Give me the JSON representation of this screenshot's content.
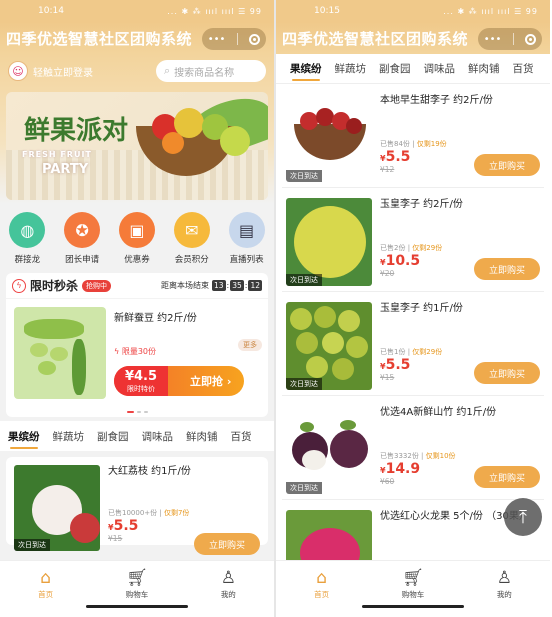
{
  "app_title": "四季优选智慧社区团购系统",
  "left": {
    "time": "10:14",
    "status_icons": "... ✱ ⁂ ıııl ıııl ☰ 99",
    "login_text": "轻触立即登录",
    "search_placeholder": "搜索商品名称",
    "banner": {
      "big": "鲜果派对",
      "sub1": "FRESH FRUIT",
      "sub2": "PARTY"
    },
    "quick_icons": [
      {
        "label": "群接龙",
        "icon": "leaf-icon",
        "color": "#45c49a",
        "glyph": "◍"
      },
      {
        "label": "团长申请",
        "icon": "badge-icon",
        "color": "#f4793e",
        "glyph": "✪"
      },
      {
        "label": "优惠券",
        "icon": "coupon-icon",
        "color": "#f57b39",
        "glyph": "▣"
      },
      {
        "label": "会员积分",
        "icon": "points-icon",
        "color": "#f6b93b",
        "glyph": "✉"
      },
      {
        "label": "直播列表",
        "icon": "live-icon",
        "color": "#c7d7ec",
        "glyph": "▤"
      }
    ],
    "flash": {
      "title": "限时秒杀",
      "tag": "抢购中",
      "end_label": "距离本场结束",
      "timer": [
        "13",
        "35",
        "12"
      ],
      "product": "新鲜蚕豆 约2斤/份",
      "limit": "限量30份",
      "more": "更多",
      "price": "¥4.5",
      "price_label": "限时特价",
      "grab": "立即抢"
    },
    "categories": [
      "果缤纷",
      "鲜蔬坊",
      "副食园",
      "调味品",
      "鲜肉铺",
      "百货"
    ],
    "product": {
      "name": "大红荔枝 约1斤/份",
      "sold": "已售10000+份",
      "limit": "仅剩7份",
      "price": "5.5",
      "oprice": "¥15",
      "badge": "次日到达",
      "buy": "立即购买"
    }
  },
  "right": {
    "time": "10:15",
    "status_icons": "... ✱ ⁂ ıııl ıııl ☰ 99",
    "categories": [
      "果缤纷",
      "鲜蔬坊",
      "副食园",
      "调味品",
      "鲜肉铺",
      "百货"
    ],
    "products": [
      {
        "name": "本地早生甜李子 约2斤/份",
        "sold": "已售84份",
        "limit": "仅剩19份",
        "price": "5.5",
        "oprice": "¥12",
        "badge": "次日到达",
        "buy": "立即购买"
      },
      {
        "name": "玉皇李子 约2斤/份",
        "sold": "已售2份",
        "limit": "仅剩29份",
        "price": "10.5",
        "oprice": "¥20",
        "badge": "次日到达",
        "buy": "立即购买"
      },
      {
        "name": "玉皇李子 约1斤/份",
        "sold": "已售1份",
        "limit": "仅剩29份",
        "price": "5.5",
        "oprice": "¥15",
        "badge": "次日到达",
        "buy": "立即购买"
      },
      {
        "name": "优选4A新鲜山竹 约1斤/份",
        "sold": "已售3332份",
        "limit": "仅剩10份",
        "price": "14.9",
        "oprice": "¥60",
        "badge": "次日到达",
        "buy": "立即购买"
      },
      {
        "name": "优选红心火龙果 5个/份 （30果）",
        "sold": "",
        "limit": "",
        "price": "",
        "oprice": "",
        "badge": "",
        "buy": ""
      }
    ]
  },
  "tabs": [
    {
      "label": "首页",
      "icon": "home-icon"
    },
    {
      "label": "购物车",
      "icon": "cart-icon"
    },
    {
      "label": "我的",
      "icon": "user-icon"
    }
  ],
  "yuan": "¥",
  "colors": {
    "accent": "#efaa4c",
    "price": "#e53e30",
    "header": "#f0c98a"
  }
}
